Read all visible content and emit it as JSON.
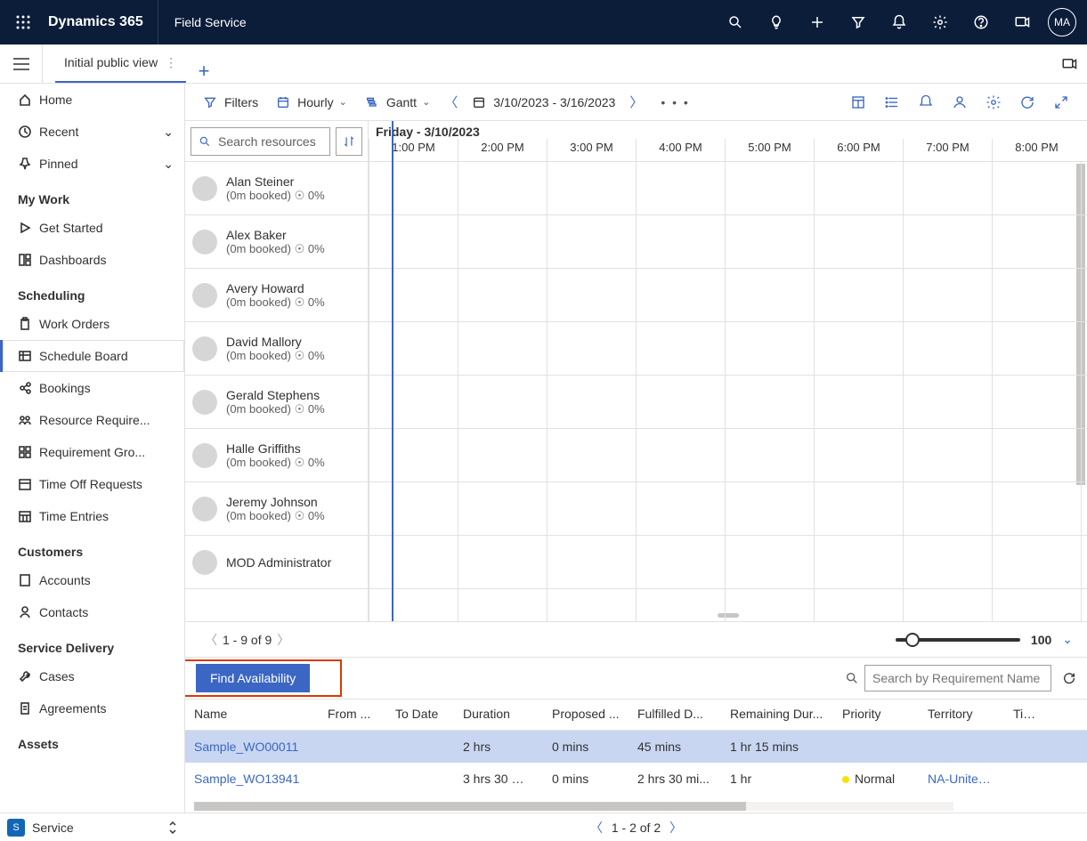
{
  "top": {
    "brand": "Dynamics 365",
    "module": "Field Service",
    "avatar": "MA"
  },
  "tabs": {
    "active": "Initial public view"
  },
  "nav": {
    "items_top": [
      {
        "label": "Home",
        "icon": "home"
      },
      {
        "label": "Recent",
        "icon": "clock",
        "expand": true
      },
      {
        "label": "Pinned",
        "icon": "pin",
        "expand": true
      }
    ],
    "my_work_header": "My Work",
    "my_work": [
      {
        "label": "Get Started",
        "icon": "play"
      },
      {
        "label": "Dashboards",
        "icon": "dash"
      }
    ],
    "scheduling_header": "Scheduling",
    "scheduling": [
      {
        "label": "Work Orders",
        "icon": "clipboard"
      },
      {
        "label": "Schedule Board",
        "icon": "board",
        "selected": true
      },
      {
        "label": "Bookings",
        "icon": "share"
      },
      {
        "label": "Resource Require...",
        "icon": "people"
      },
      {
        "label": "Requirement Gro...",
        "icon": "grid"
      },
      {
        "label": "Time Off Requests",
        "icon": "cal"
      },
      {
        "label": "Time Entries",
        "icon": "calgrid"
      }
    ],
    "customers_header": "Customers",
    "customers": [
      {
        "label": "Accounts",
        "icon": "building"
      },
      {
        "label": "Contacts",
        "icon": "person"
      }
    ],
    "sd_header": "Service Delivery",
    "sd": [
      {
        "label": "Cases",
        "icon": "wrench"
      },
      {
        "label": "Agreements",
        "icon": "doc"
      }
    ],
    "assets_header": "Assets"
  },
  "toolbar": {
    "filters": "Filters",
    "hourly": "Hourly",
    "gantt": "Gantt",
    "date_range": "3/10/2023 - 3/16/2023"
  },
  "board": {
    "search_placeholder": "Search resources",
    "day_label": "Friday - 3/10/2023",
    "hours": [
      "1:00 PM",
      "2:00 PM",
      "3:00 PM",
      "4:00 PM",
      "5:00 PM",
      "6:00 PM",
      "7:00 PM",
      "8:00 PM"
    ],
    "resources": [
      {
        "name": "Alan Steiner",
        "sub": "(0m booked)",
        "pct": "0%"
      },
      {
        "name": "Alex Baker",
        "sub": "(0m booked)",
        "pct": "0%"
      },
      {
        "name": "Avery Howard",
        "sub": "(0m booked)",
        "pct": "0%"
      },
      {
        "name": "David Mallory",
        "sub": "(0m booked)",
        "pct": "0%"
      },
      {
        "name": "Gerald Stephens",
        "sub": "(0m booked)",
        "pct": "0%"
      },
      {
        "name": "Halle Griffiths",
        "sub": "(0m booked)",
        "pct": "0%"
      },
      {
        "name": "Jeremy Johnson",
        "sub": "(0m booked)",
        "pct": "0%"
      },
      {
        "name": "MOD Administrator",
        "sub": "",
        "pct": ""
      }
    ],
    "pager": "1 - 9 of 9",
    "zoom": "100"
  },
  "find": {
    "button": "Find Availability",
    "search_placeholder": "Search by Requirement Name"
  },
  "req": {
    "headers": {
      "name": "Name",
      "from": "From ...",
      "to": "To Date",
      "dur": "Duration",
      "prop": "Proposed ...",
      "fulf": "Fulfilled D...",
      "rem": "Remaining Dur...",
      "pri": "Priority",
      "terr": "Territory",
      "time": "Time..."
    },
    "rows": [
      {
        "name": "Sample_WO00011",
        "dur": "2 hrs",
        "prop": "0 mins",
        "fulf": "45 mins",
        "rem": "1 hr 15 mins",
        "pri": "",
        "terr": "",
        "selected": true
      },
      {
        "name": "Sample_WO13941",
        "dur": "3 hrs 30 mi...",
        "prop": "0 mins",
        "fulf": "2 hrs 30 mi...",
        "rem": "1 hr",
        "pri": "Normal",
        "terr": "NA-United...",
        "selected": false
      }
    ],
    "pager": "1 - 2 of 2"
  },
  "switcher": {
    "label": "Service",
    "badge": "S"
  }
}
